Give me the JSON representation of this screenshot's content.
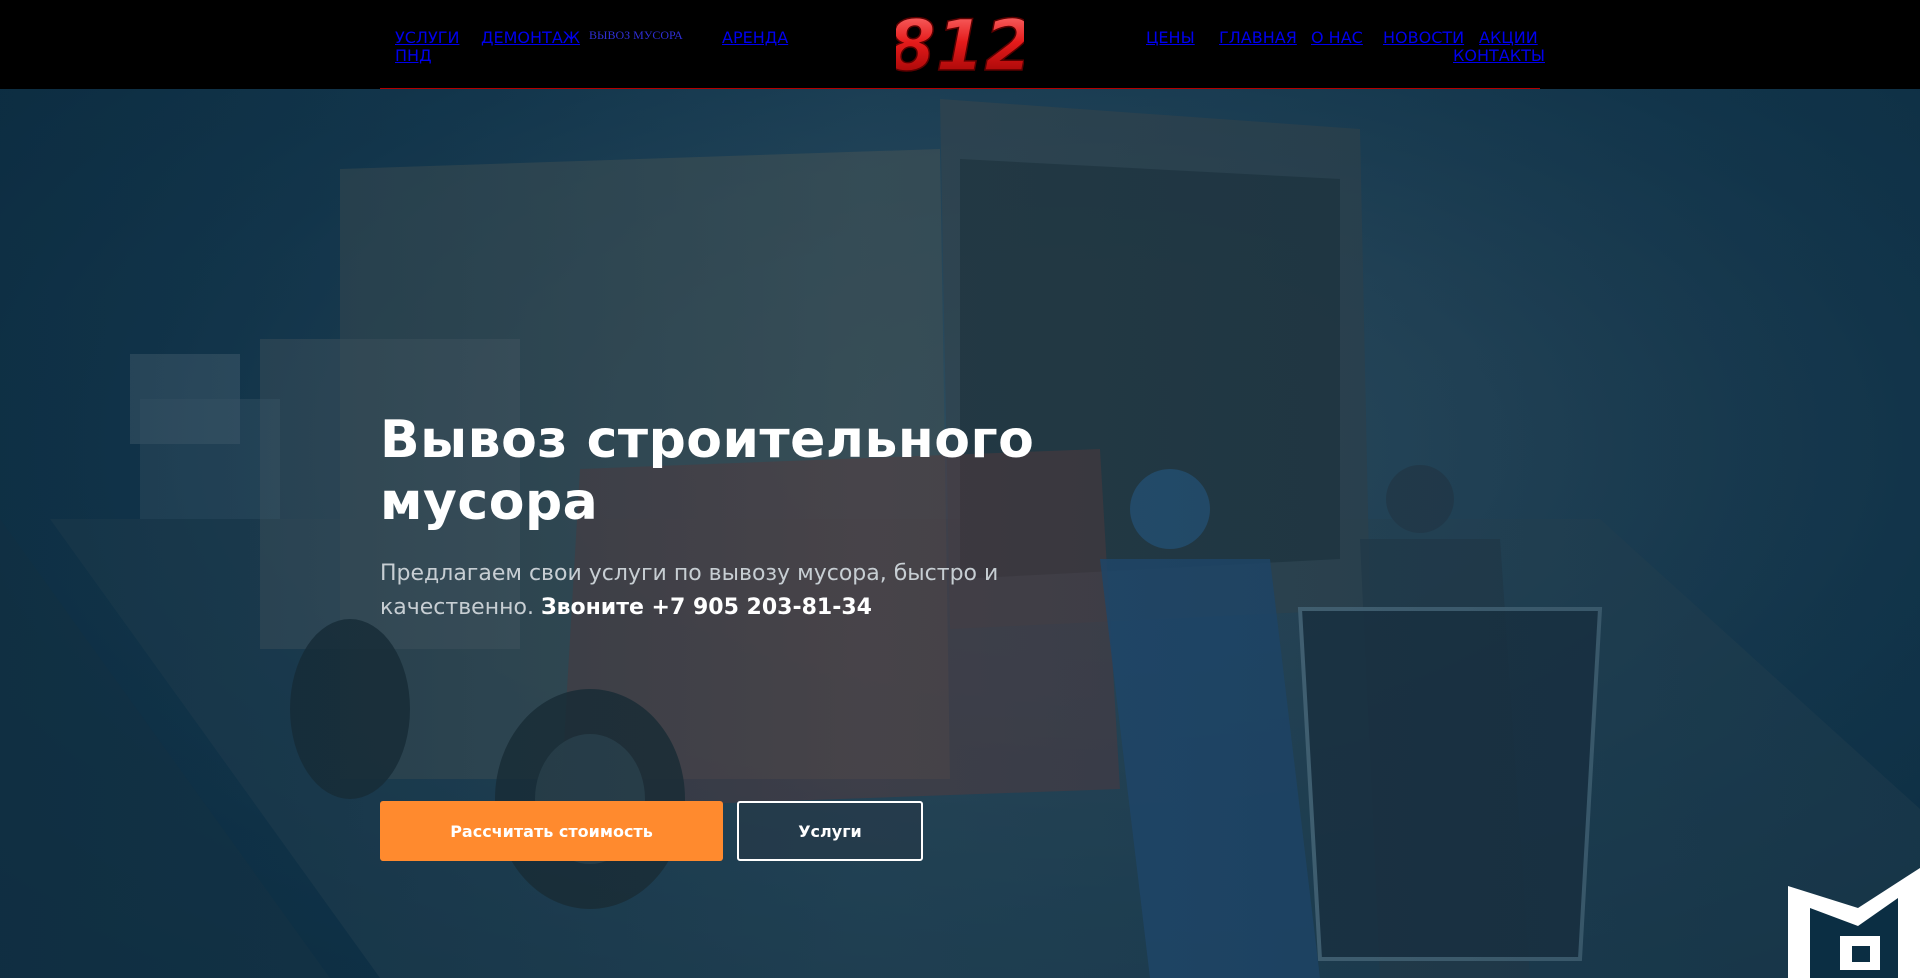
{
  "nav": {
    "left": [
      {
        "label": "УСЛУГИ",
        "active": false
      },
      {
        "label": "ПНД",
        "active": false
      },
      {
        "label": "ДЕМОНТАЖ",
        "active": false
      },
      {
        "label": "ВЫВОЗ МУСОРА",
        "active": true
      },
      {
        "label": "АРЕНДА",
        "active": false
      }
    ],
    "right": [
      {
        "label": "ЦЕНЫ"
      },
      {
        "label": "ГЛАВНАЯ"
      },
      {
        "label": "О НАС"
      },
      {
        "label": "НОВОСТИ"
      },
      {
        "label": "АКЦИИ"
      },
      {
        "label": "КОНТАКТЫ"
      }
    ]
  },
  "brand": {
    "logo_text": "812",
    "logo_color": "#e51b1b",
    "header_bg": "#000000",
    "nav_color": "#e01b1b",
    "nav_active_color": "#2f2fd6"
  },
  "hero": {
    "title": "Вывоз строительного мусора",
    "subtitle_plain": "Предлагаем свои услуги по вывозу мусора, быстро и качественно. ",
    "subtitle_bold": "Звоните +7 905 203-81-34",
    "primary_button": "Рассчитать стоимость",
    "secondary_button": "Услуги",
    "accent_color": "#ff8a2e"
  },
  "icons": {
    "logo": "812-logo",
    "corner": "corner-badge-icon"
  }
}
